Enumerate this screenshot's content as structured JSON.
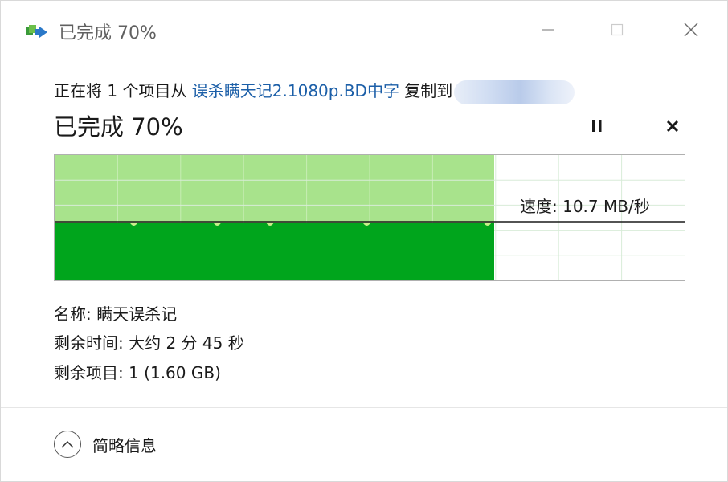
{
  "window": {
    "title": "已完成 70%"
  },
  "copy": {
    "prefix": "正在将 1 个项目从 ",
    "source": "误杀瞒天记2.1080p.BD中字",
    "middle": " 复制到"
  },
  "status": {
    "text": "已完成 70%",
    "progress": 0.7
  },
  "speed": {
    "label": "速度: 10.7 MB/秒"
  },
  "details": {
    "name": "名称: 瞒天误杀记",
    "time_remaining": "剩余时间: 大约 2 分 45 秒",
    "items_remaining": "剩余项目: 1 (1.60 GB)"
  },
  "toggle": {
    "label": "简略信息"
  },
  "colors": {
    "progress_fill": "#00a51c",
    "progress_history": "#a8e38c",
    "link": "#1c5fa8"
  },
  "icons": {
    "app": "copy-transfer-icon",
    "minimize": "minimize-icon",
    "maximize": "maximize-icon",
    "close": "close-icon",
    "pause": "pause-icon",
    "stop": "stop-icon",
    "chevron": "chevron-up-icon"
  }
}
